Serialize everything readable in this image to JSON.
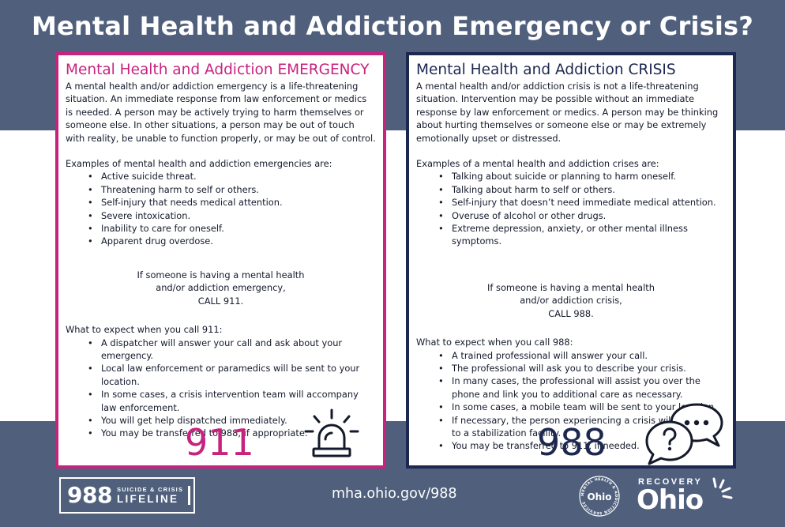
{
  "title": "Mental Health and Addiction Emergency or Crisis?",
  "emergency": {
    "heading": "Mental Health and Addiction EMERGENCY",
    "intro": "A mental health and/or addiction emergency is a life-threatening situation. An immediate response from law enforcement or medics is needed.  A person may be actively trying to harm themselves or someone else. In other situations, a person may be out of touch with reality, be unable to function properly, or may be out of control.",
    "examples_heading": "Examples of mental health and addiction emergencies are:",
    "examples": [
      "Active suicide threat.",
      "Threatening harm to self or others.",
      "Self-injury that needs medical attention.",
      "Severe intoxication.",
      "Inability to care for oneself.",
      "Apparent drug overdose."
    ],
    "call_lines": [
      "If someone is having a mental health",
      "and/or addiction emergency,",
      "CALL 911."
    ],
    "expect_heading": "What to expect when you call 911:",
    "expect": [
      "A dispatcher will answer your call and ask about your emergency.",
      "Local law enforcement or paramedics will be sent to your location.",
      "In some cases, a crisis intervention team will accompany law enforcement.",
      "You will get help dispatched immediately.",
      "You may be transferred to 988, if appropriate."
    ],
    "number": "911",
    "icon": "siren-icon"
  },
  "crisis": {
    "heading": "Mental Health and Addiction CRISIS",
    "intro": "A mental health and/or addiction crisis is not a life-threatening situation. Intervention may be possible without an immediate response by law enforcement or medics. A person may be thinking about hurting themselves or someone else or may be extremely emotionally upset or distressed.",
    "examples_heading": "Examples of a mental health and addiction crises are:",
    "examples": [
      "Talking about suicide or planning to harm oneself.",
      "Talking about harm to self or others.",
      "Self-injury that doesn’t need immediate medical attention.",
      "Overuse of alcohol or other drugs.",
      "Extreme depression, anxiety, or other mental illness symptoms."
    ],
    "call_lines": [
      "If someone is having a mental health",
      "and/or addiction crisis,",
      "CALL 988."
    ],
    "expect_heading": "What to expect when you call 988:",
    "expect": [
      "A trained professional will answer your call.",
      "The professional will ask you to describe your crisis.",
      "In many cases, the professional will assist you over the phone and link you to additional care as necessary.",
      "In some cases, a mobile team will be sent to your location.",
      "If necessary, the person experiencing a crisis will be taken to a stabilization facility.",
      "You may be transferred to 911, if needed."
    ],
    "number": "988",
    "icon": "speech-bubbles-icon"
  },
  "footer": {
    "lifeline_number": "988",
    "lifeline_small": "SUICIDE & CRISIS",
    "lifeline_big": "LIFELINE",
    "url": "mha.ohio.gov/988",
    "mha_logo_text": "MENTAL HEALTH & ADDICTION SERVICES",
    "mha_logo_ohio": "Ohio",
    "recovery_label": "RECOVERY",
    "recovery_ohio": "Ohio"
  },
  "colors": {
    "band": "#4f5f7c",
    "emergency": "#c8227f",
    "crisis": "#1d2851",
    "background": "#ffffff"
  }
}
